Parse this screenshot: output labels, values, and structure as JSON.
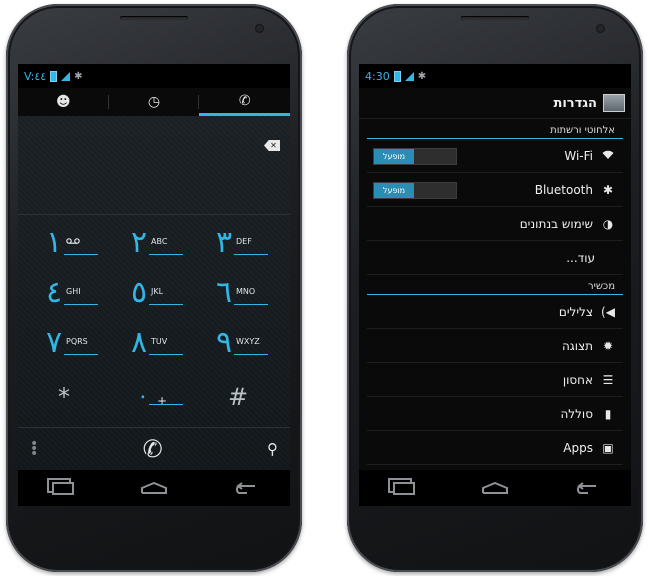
{
  "dialer": {
    "status": {
      "time": "V:٤٤"
    },
    "tabs": [
      {
        "icon": "contacts-icon",
        "active": false
      },
      {
        "icon": "clock-icon",
        "active": false
      },
      {
        "icon": "phone-icon",
        "active": true
      }
    ],
    "keys": [
      {
        "num": "١",
        "sub": "voicemail"
      },
      {
        "num": "٢",
        "sub": "ABC"
      },
      {
        "num": "٣",
        "sub": "DEF"
      },
      {
        "num": "٤",
        "sub": "GHI"
      },
      {
        "num": "٥",
        "sub": "JKL"
      },
      {
        "num": "٦",
        "sub": "MNO"
      },
      {
        "num": "٧",
        "sub": "PQRS"
      },
      {
        "num": "٨",
        "sub": "TUV"
      },
      {
        "num": "٩",
        "sub": "WXYZ"
      },
      {
        "num": "*",
        "sub": ""
      },
      {
        "num": "٠",
        "sub": "+"
      },
      {
        "num": "#",
        "sub": ""
      }
    ]
  },
  "settings": {
    "status": {
      "time": "4:30"
    },
    "title": "הגדרות",
    "sections": [
      {
        "header": "אלחוטי ורשתות"
      },
      {
        "header": "מכשיר"
      }
    ],
    "wifi": {
      "label": "Wi-Fi",
      "toggle": "מופעל"
    },
    "bluetooth": {
      "label": "Bluetooth",
      "toggle": "מופעל"
    },
    "data_usage": {
      "label": "שימוש בנתונים"
    },
    "more": {
      "label": "עוד..."
    },
    "sound": {
      "label": "צלילים"
    },
    "display": {
      "label": "תצוגה"
    },
    "storage": {
      "label": "אחסון"
    },
    "battery": {
      "label": "סוללה"
    },
    "apps": {
      "label": "Apps"
    }
  },
  "colors": {
    "accent": "#33b5e5",
    "toggle_on": "#2b8cb4"
  }
}
